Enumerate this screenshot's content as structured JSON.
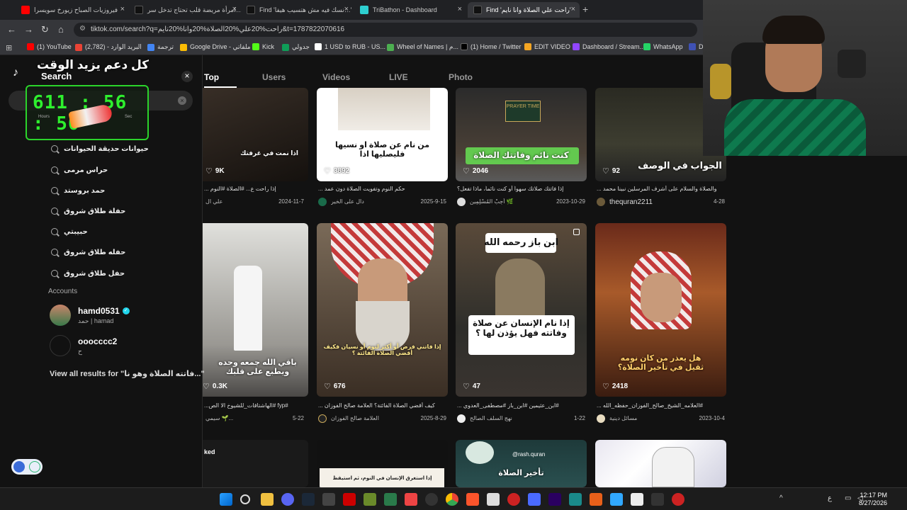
{
  "browser": {
    "tabs": [
      {
        "label": "فيروزيات الصباح زيورخ سويسرا",
        "favicon_color": "#ff0000"
      },
      {
        "label": "امرأة مريضة قلب تحتاج تدخل سر…",
        "favicon_color": "#111111"
      },
      {
        "label": "Find 'نسك فيه مش هتسيب هيفا…'",
        "favicon_color": "#111111"
      },
      {
        "label": "TriBathon - Dashboard",
        "favicon_color": "#2ecfd0"
      },
      {
        "label": "Find 'راحت علي الصلاة وانا نايم'",
        "favicon_color": "#111111"
      }
    ],
    "new_tab": "+",
    "url": "tiktok.com/search?q=راحت%20علي%20الصلاة%20وانا%20نايم&t=1787822070616",
    "bookmarks": [
      {
        "label": "(1) YouTube",
        "color": "#ff0000"
      },
      {
        "label": "البريد الوارد - (2,782)",
        "color": "#ea4335"
      },
      {
        "label": "ترجمة",
        "color": "#4285f4"
      },
      {
        "label": "Google Drive - ملفاتي",
        "color": "#fbbc04"
      },
      {
        "label": "Kick",
        "color": "#53fc18"
      },
      {
        "label": "جدولي",
        "color": "#0f9d58"
      },
      {
        "label": "1 USD to RUB - US...",
        "color": "#ffffff"
      },
      {
        "label": "Wheel of Names | م...",
        "color": "#4caf50"
      },
      {
        "label": "(1) Home / Twitter",
        "color": "#000000"
      },
      {
        "label": "EDIT VIDEO",
        "color": "#f5a623"
      },
      {
        "label": "Dashboard / Stream...",
        "color": "#9146ff"
      },
      {
        "label": "WhatsApp",
        "color": "#25d366"
      },
      {
        "label": "D",
        "color": "#3f51b5"
      }
    ]
  },
  "overlay": {
    "top_text": "كل دعم يزيد الوقت",
    "timer": "611 : 56 : 50",
    "hours_label": "Hours",
    "sec_label": "Sec"
  },
  "search_panel": {
    "title": "Search",
    "close": "×",
    "suggestions": [
      "حيوانات حديقة الحيوانات",
      "حراس مرمى",
      "حمد بروستد",
      "حفلة طلاق شروق",
      "حبيبتي",
      "حفله طلاق شروق",
      "حفل طلاق شروق"
    ],
    "accounts_heading": "Accounts",
    "accounts": [
      {
        "name": "hamd0531",
        "sub": "حمد | hamad",
        "verified": true
      },
      {
        "name": "ooocccc2",
        "sub": "ح",
        "verified": false
      }
    ],
    "view_all": "View all results for \"فاتته الصلاة وهو نا...\""
  },
  "result_tabs": [
    "Top",
    "Users",
    "Videos",
    "LIVE",
    "Photo"
  ],
  "cards_row1": [
    {
      "likes": "9K",
      "caption": "اذا نمت في غرفتك",
      "desc": "إذا راحت ع... #الصلاة #النوم ...",
      "author": "علي ال",
      "date": "2024-11-7"
    },
    {
      "likes": "3892",
      "caption": "من نام عن صلاة او نسيها فليصليها اذا",
      "desc": "حكم النوم وتفويت الصلاة دون عمد ...",
      "author": "دال على الخير",
      "date": "2025-9-15"
    },
    {
      "likes": "2046",
      "caption": "كنت نائم وفاتتك الصلاة",
      "desc": "إذا فاتتك صلاتك سهواً أو كنت نائماً، ماذا تفعل؟",
      "author": "أَجِبْ المُسْلِمِين 🌿",
      "date": "2023-10-29"
    },
    {
      "likes": "92",
      "caption": "الجواب في الوصف",
      "desc": "والصلاة والسلام على أشرف المرسلين نبينا محمد ...",
      "author": "thequran2211",
      "date": "4-28"
    }
  ],
  "cards_row2": [
    {
      "likes": "0.3K",
      "caption": "باقي الله جمعه وحده ويطبع على قلبك",
      "desc": "#fyp #الهاشتاقات_للشيوخ الا الص...",
      "author": "سيمي 🌱...",
      "date": "5-22"
    },
    {
      "likes": "676",
      "caption": "إذا فاتني فرض أو أكثر لنوم أو نسيان فكيف أقضي الصلاة الفائتة ؟",
      "desc": "كيف أقضي الصلاة الفائتة؟ العلامة صالح الفوزان ...",
      "author": "العلامة صالح الفوزان",
      "date": "2025-8-29"
    },
    {
      "likes": "47",
      "caption": "إذا نام الإنسان عن صلاة وفاتته فهل يؤذن لها ؟",
      "top_caption": "ابن باز رحمه الله",
      "desc": "#ابن_عثيمين #ابن_باز #مصطفى_العدوي ...",
      "author": "نهج السلف الصالح",
      "date": "1-22"
    },
    {
      "likes": "2418",
      "caption": "هل يعذر من كان نومه ثقيل في تأخير الصلاة؟",
      "desc": "#العلامه_الشيخ_صالح_الفوزان_حفظه_الله ...",
      "author": "مسائل دينية",
      "date": "2023-10-4"
    }
  ],
  "cards_row3": [
    {
      "caption": "ked"
    },
    {
      "caption": "إذا استغرق الإنسان في النوم، ثم استيقظ"
    },
    {
      "caption": "@rash.quran",
      "sub": "تأخير الصلاة"
    },
    {
      "caption": ""
    }
  ],
  "taskbar": {
    "time": "12:17 PM",
    "date": "8/27/2026",
    "lang": "ع"
  }
}
